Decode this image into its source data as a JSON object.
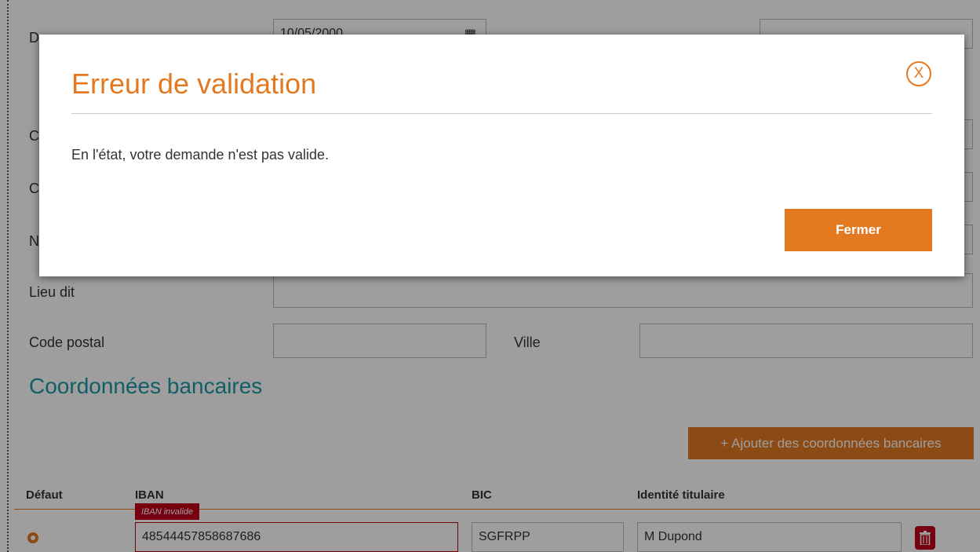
{
  "form": {
    "date_value": "10/05/2000",
    "row_initials": [
      "D",
      "C",
      "C",
      "N"
    ],
    "lieu_dit_label": "Lieu dit",
    "code_postal_label": "Code postal",
    "ville_label": "Ville"
  },
  "bank_section": {
    "title": "Coordonnées bancaires",
    "add_button": "+ Ajouter des coordonnées bancaires",
    "columns": [
      "Défaut",
      "IBAN",
      "BIC",
      "Identité titulaire"
    ],
    "row": {
      "iban_error": "IBAN invalide",
      "iban": "48544457858687686",
      "bic": "SGFRPP",
      "holder": "M Dupond"
    }
  },
  "modal": {
    "title": "Erreur de validation",
    "close_icon": "X",
    "message": "En l'état, votre demande n'est pas valide.",
    "close_button": "Fermer"
  },
  "colors": {
    "accent": "#e37a22",
    "section_title": "#1a9aa6",
    "error": "#c0001a"
  }
}
